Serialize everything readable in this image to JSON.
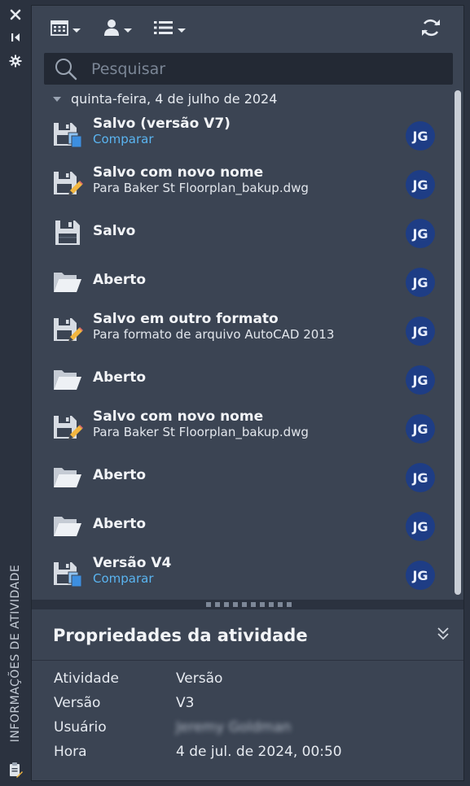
{
  "palette": {
    "panel_bg": "#3b4453",
    "sidebar_bg": "#2b323f",
    "avatar_bg": "#1e3d85",
    "link": "#5ab4f0"
  },
  "sidebar": {
    "vertical_title": "INFORMAÇÕES DE ATIVIDADE",
    "icons": [
      "close-icon",
      "pin-collapse-icon",
      "settings-icon",
      "clipboard-icon"
    ]
  },
  "toolbar": {
    "icons": [
      "calendar-filter-icon",
      "user-filter-icon",
      "list-filter-icon",
      "refresh-icon"
    ]
  },
  "search": {
    "placeholder": "Pesquisar"
  },
  "date_group": {
    "label": "quinta-feira, 4 de julho de 2024"
  },
  "activities": [
    {
      "icon": "save-version-icon",
      "title": "Salvo (versão V7)",
      "subtitle": "Comparar",
      "subtitle_is_link": true,
      "avatar": "JG"
    },
    {
      "icon": "save-as-icon",
      "title": "Salvo com novo nome",
      "subtitle": "Para Baker St Floorplan_bakup.dwg",
      "subtitle_is_link": false,
      "avatar": "JG"
    },
    {
      "icon": "save-icon",
      "title": "Salvo",
      "subtitle": "",
      "subtitle_is_link": false,
      "avatar": "JG"
    },
    {
      "icon": "folder-open-icon",
      "title": "Aberto",
      "subtitle": "",
      "subtitle_is_link": false,
      "avatar": "JG"
    },
    {
      "icon": "save-as-icon",
      "title": "Salvo em outro formato",
      "subtitle": "Para formato de arquivo AutoCAD 2013",
      "subtitle_is_link": false,
      "avatar": "JG"
    },
    {
      "icon": "folder-open-icon",
      "title": "Aberto",
      "subtitle": "",
      "subtitle_is_link": false,
      "avatar": "JG"
    },
    {
      "icon": "save-as-icon",
      "title": "Salvo com novo nome",
      "subtitle": "Para Baker St Floorplan_bakup.dwg",
      "subtitle_is_link": false,
      "avatar": "JG"
    },
    {
      "icon": "folder-open-icon",
      "title": "Aberto",
      "subtitle": "",
      "subtitle_is_link": false,
      "avatar": "JG"
    },
    {
      "icon": "folder-open-icon",
      "title": "Aberto",
      "subtitle": "",
      "subtitle_is_link": false,
      "avatar": "JG"
    },
    {
      "icon": "save-version-icon",
      "title": "Versão V4",
      "subtitle": "Comparar",
      "subtitle_is_link": true,
      "avatar": "JG"
    }
  ],
  "properties": {
    "title": "Propriedades da atividade",
    "rows": [
      {
        "label": "Atividade",
        "value": "Versão"
      },
      {
        "label": "Versão",
        "value": "V3"
      },
      {
        "label": "Usuário",
        "value": "Jeremy Goldman",
        "blurred": true
      },
      {
        "label": "Hora",
        "value": "4 de jul. de 2024, 00:50"
      }
    ]
  }
}
